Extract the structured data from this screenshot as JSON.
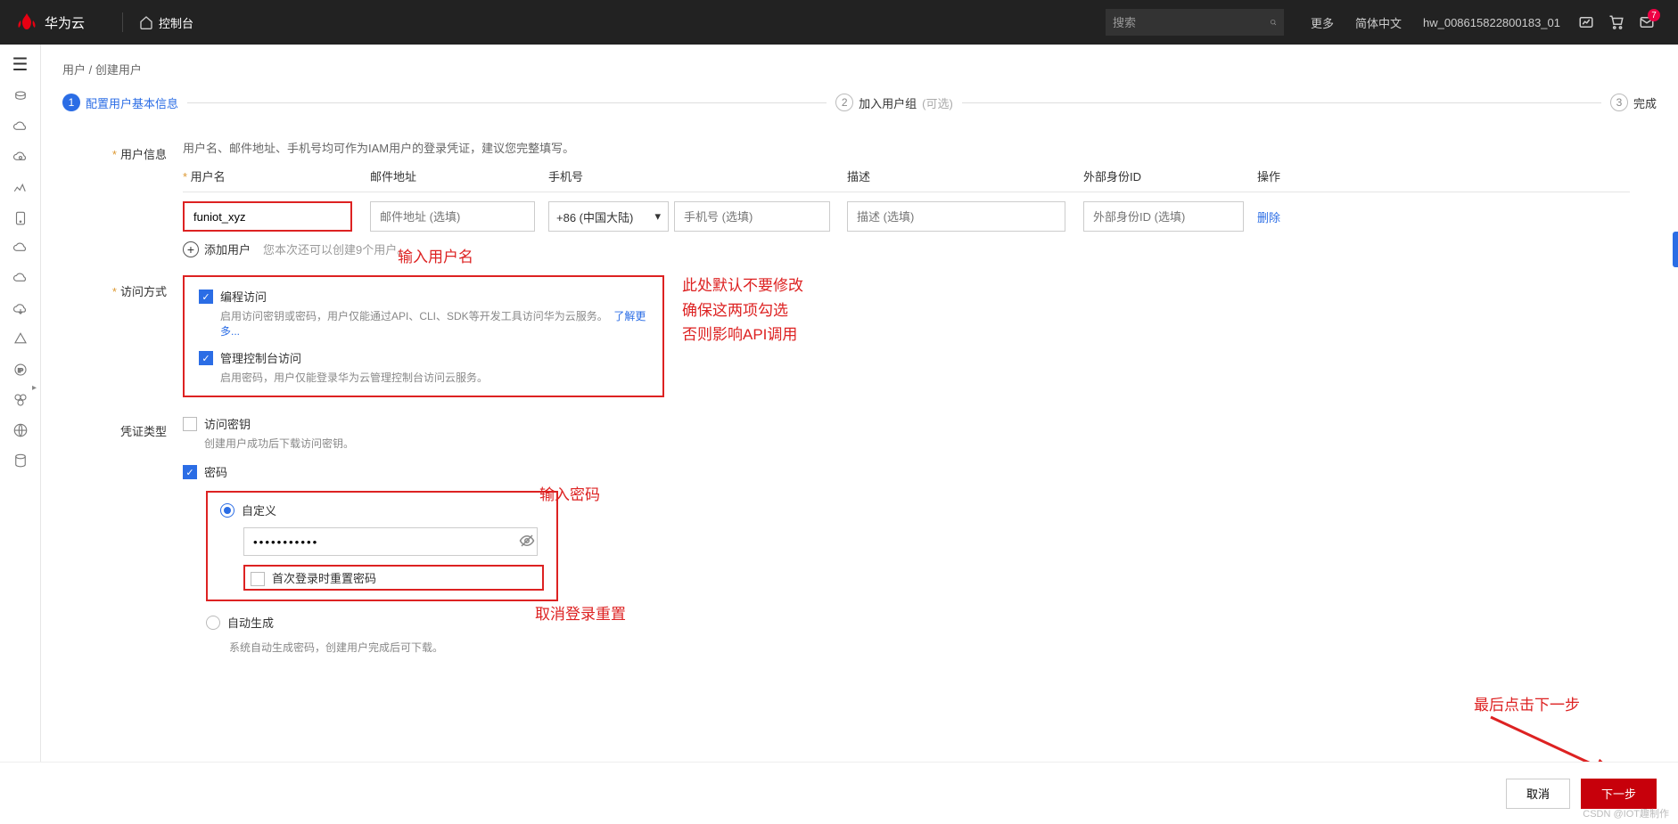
{
  "header": {
    "brand": "华为云",
    "console": "控制台",
    "search_placeholder": "搜索",
    "more": "更多",
    "lang": "简体中文",
    "user": "hw_008615822800183_01",
    "badge": "7"
  },
  "crumb": {
    "a": "用户",
    "b": "创建用户"
  },
  "stepper": {
    "s1": "配置用户基本信息",
    "s2": "加入用户组",
    "s2opt": "(可选)",
    "s3": "完成"
  },
  "form": {
    "userInfoLabel": "用户信息",
    "userInfoHint": "用户名、邮件地址、手机号均可作为IAM用户的登录凭证，建议您完整填写。",
    "cols": {
      "username": "用户名",
      "email": "邮件地址",
      "phone": "手机号",
      "desc": "描述",
      "ext": "外部身份ID",
      "op": "操作"
    },
    "row": {
      "username": "funiot_xyz",
      "email_ph": "邮件地址 (选填)",
      "phone_code": "+86 (中国大陆)",
      "phone_ph": "手机号 (选填)",
      "desc_ph": "描述 (选填)",
      "ext_ph": "外部身份ID (选填)",
      "delete": "删除"
    },
    "add": {
      "label": "添加用户",
      "tip": "您本次还可以创建9个用户。"
    },
    "accessLabel": "访问方式",
    "access": {
      "prog": "编程访问",
      "prog_desc": "启用访问密钥或密码，用户仅能通过API、CLI、SDK等开发工具访问华为云服务。",
      "learn": "了解更多...",
      "console": "管理控制台访问",
      "console_desc": "启用密码，用户仅能登录华为云管理控制台访问云服务。"
    },
    "credLabel": "凭证类型",
    "cred": {
      "ak": "访问密钥",
      "ak_desc": "创建用户成功后下载访问密钥。",
      "pwd": "密码",
      "custom": "自定义",
      "pwd_value": "•••••••••••",
      "reset": "首次登录时重置密码",
      "auto": "自动生成",
      "auto_desc": "系统自动生成密码，创建用户完成后可下载。"
    }
  },
  "annot": {
    "a1": "输入用户名",
    "a2": "此处默认不要修改\n确保这两项勾选\n否则影响API调用",
    "a3": "输入密码",
    "a4": "取消登录重置",
    "a5": "最后点击下一步"
  },
  "footer": {
    "cancel": "取消",
    "next": "下一步"
  },
  "watermark": "CSDN @IOT趣制作"
}
